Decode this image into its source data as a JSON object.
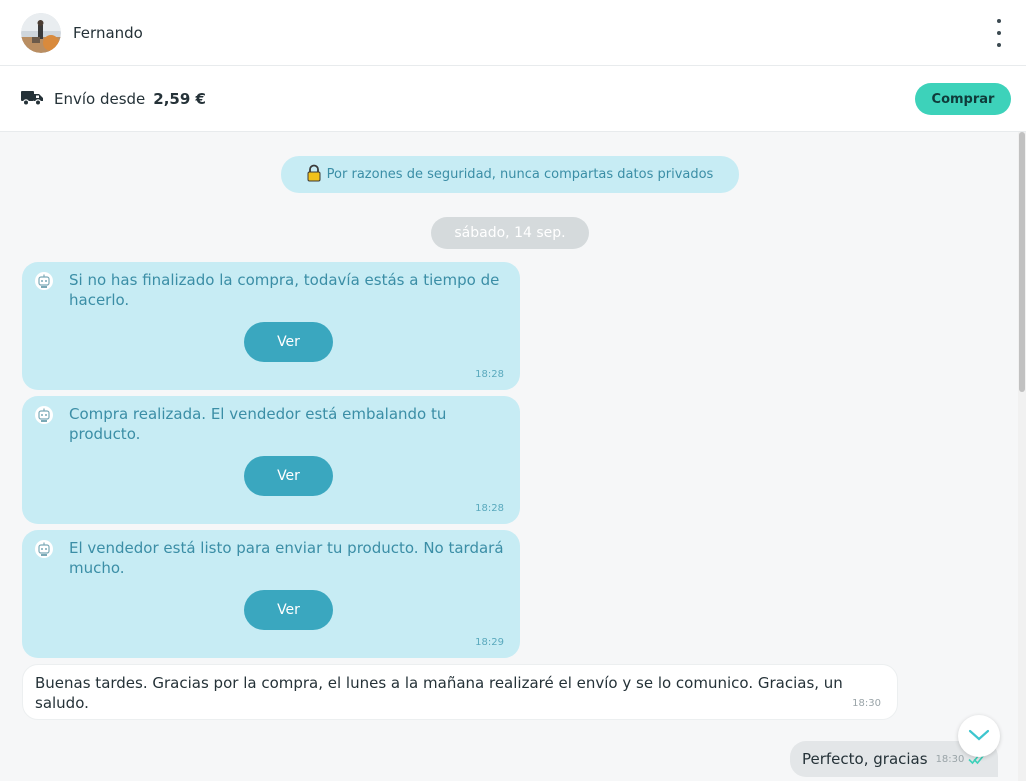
{
  "header": {
    "user_name": "Fernando"
  },
  "shipping": {
    "label": "Envío desde",
    "price": "2,59 €",
    "buy_label": "Comprar"
  },
  "chat": {
    "security_notice": "Por razones de seguridad, nunca compartas datos privados",
    "date": "sábado, 14 sep.",
    "bot_messages": [
      {
        "text": "Si no has finalizado la compra, todavía estás a tiempo de hacerlo.",
        "button": "Ver",
        "time": "18:28"
      },
      {
        "text": "Compra realizada. El vendedor está embalando tu producto.",
        "button": "Ver",
        "time": "18:28"
      },
      {
        "text": "El vendedor está listo para enviar tu producto. No tardará mucho.",
        "button": "Ver",
        "time": "18:29"
      }
    ],
    "incoming": {
      "text": "Buenas tardes. Gracias por la compra, el lunes a la mañana realizaré el envío y se lo comunico. Gracias, un saludo.",
      "time": "18:30"
    },
    "outgoing": {
      "text": "Perfecto, gracias",
      "time": "18:30"
    }
  },
  "colors": {
    "accent": "#3dd2ba",
    "bot_bubble": "#c7ecf4",
    "bot_text": "#3b8ea6",
    "ver_button": "#3aa7bf"
  },
  "icons": [
    "avatar",
    "kebab-menu-icon",
    "truck-icon",
    "lock-icon",
    "robot-icon",
    "double-check-icon",
    "chevron-down-icon"
  ]
}
